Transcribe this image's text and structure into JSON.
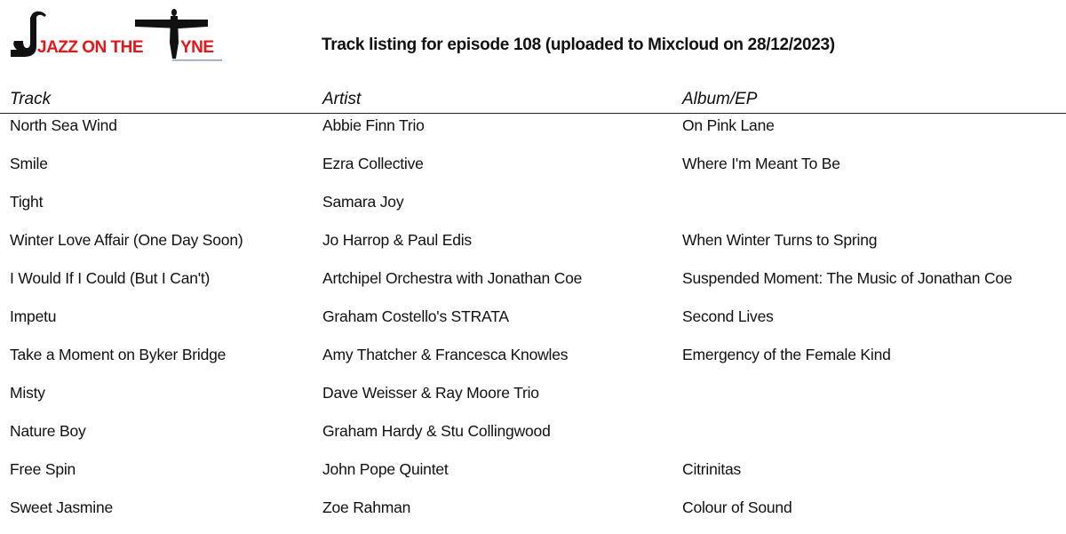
{
  "logo": {
    "text_part1": "JAZZ ON THE",
    "text_part2": "YNE",
    "colors": {
      "red": "#e3161b",
      "black": "#111111"
    }
  },
  "title": "Track listing for episode 108 (uploaded to Mixcloud on 28/12/2023)",
  "table": {
    "headers": [
      "Track",
      "Artist",
      "Album/EP"
    ],
    "rows": [
      [
        "North Sea Wind",
        "Abbie Finn Trio",
        "On Pink Lane"
      ],
      [
        "Smile",
        "Ezra Collective",
        "Where I'm Meant To Be"
      ],
      [
        "Tight",
        "Samara Joy",
        ""
      ],
      [
        "Winter Love Affair (One Day Soon)",
        "Jo Harrop & Paul Edis",
        "When Winter Turns to Spring"
      ],
      [
        "I Would If I Could (But I Can't)",
        "Artchipel Orchestra with Jonathan Coe",
        "Suspended Moment: The Music of Jonathan Coe"
      ],
      [
        "Impetu",
        "Graham Costello's STRATA",
        "Second Lives"
      ],
      [
        "Take a Moment on Byker Bridge",
        "Amy Thatcher & Francesca Knowles",
        "Emergency of the Female Kind"
      ],
      [
        "Misty",
        "Dave Weisser & Ray Moore Trio",
        ""
      ],
      [
        "Nature Boy",
        "Graham Hardy & Stu Collingwood",
        ""
      ],
      [
        "Free Spin",
        "John Pope Quintet",
        "Citrinitas"
      ],
      [
        "Sweet Jasmine",
        "Zoe Rahman",
        "Colour of Sound"
      ]
    ]
  }
}
